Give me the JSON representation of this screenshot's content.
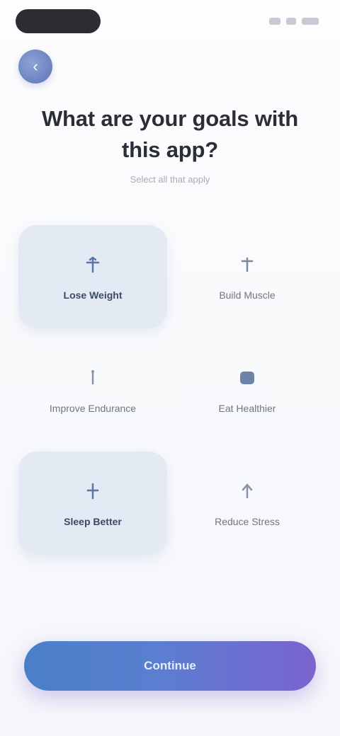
{
  "status_bar": {
    "time": "",
    "icons": [
      "signal-icon",
      "wifi-icon",
      "battery-icon"
    ]
  },
  "nav": {
    "back_icon": "back-arrow-icon"
  },
  "header": {
    "title": "What are your goals with this app?",
    "subtitle": "Select all that apply"
  },
  "options": [
    {
      "label": "Lose Weight",
      "icon": "scale-icon",
      "selected": true
    },
    {
      "label": "Build Muscle",
      "icon": "dumbbell-icon",
      "selected": false
    },
    {
      "label": "Improve Endurance",
      "icon": "runner-icon",
      "selected": false
    },
    {
      "label": "Eat Healthier",
      "icon": "apple-icon",
      "selected": false
    },
    {
      "label": "Sleep Better",
      "icon": "moon-icon",
      "selected": true
    },
    {
      "label": "Reduce Stress",
      "icon": "leaf-icon",
      "selected": false
    }
  ],
  "cta": {
    "label": "Continue"
  },
  "colors": {
    "selected_card": "#e3eaf4",
    "cta_start": "#4a7fc8",
    "cta_end": "#7a63cf",
    "accent": "#5c73b5"
  }
}
